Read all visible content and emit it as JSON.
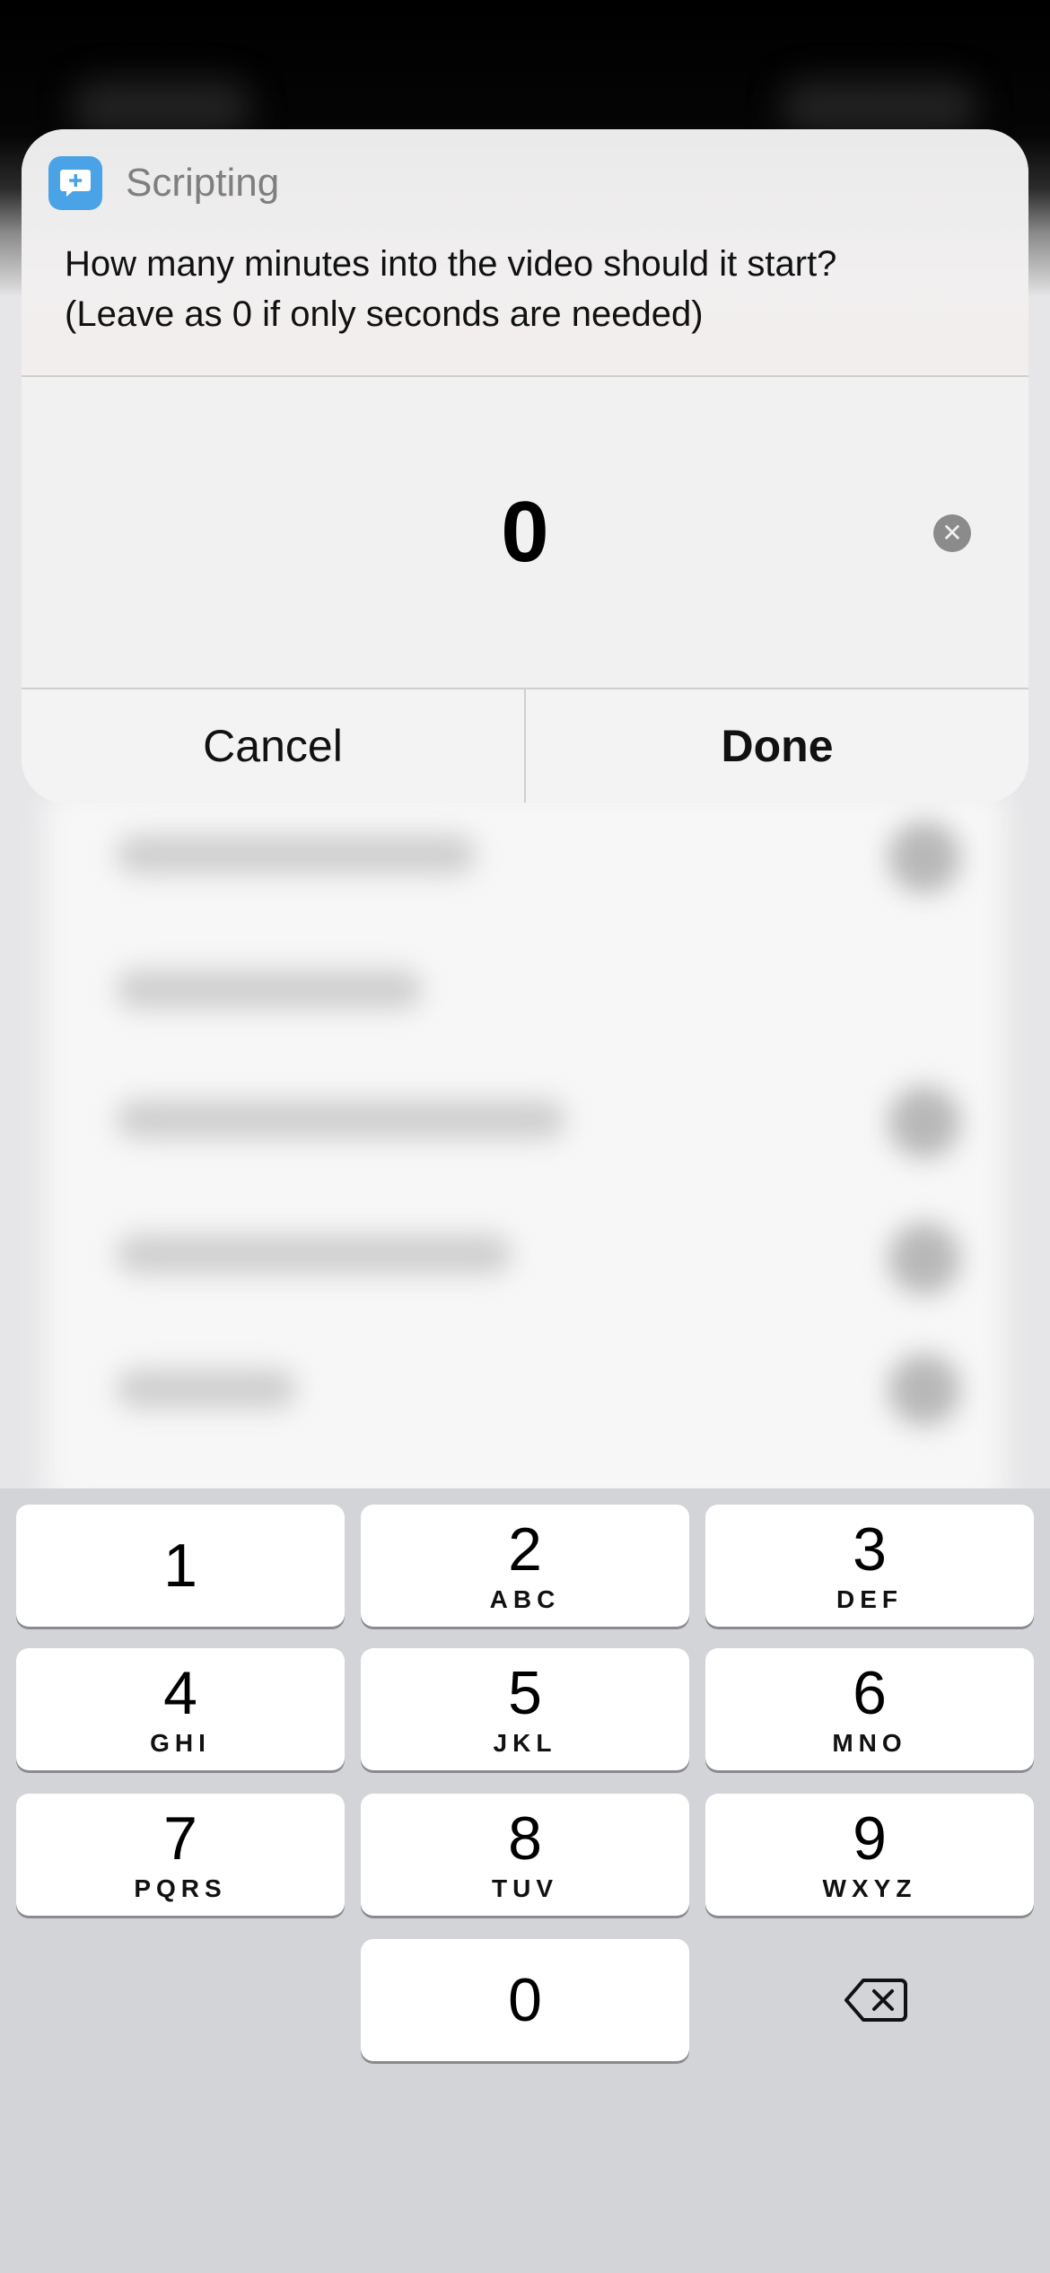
{
  "alert": {
    "app_name": "Scripting",
    "app_icon": "chat-bubble-plus-icon",
    "message_line1": "How many minutes into the video should it start?",
    "message_line2": "(Leave as 0 if only seconds are needed)",
    "input_value": "0",
    "clear_icon": "clear-x-icon",
    "cancel_label": "Cancel",
    "done_label": "Done"
  },
  "keypad": {
    "keys": [
      {
        "digit": "1",
        "letters": ""
      },
      {
        "digit": "2",
        "letters": "ABC"
      },
      {
        "digit": "3",
        "letters": "DEF"
      },
      {
        "digit": "4",
        "letters": "GHI"
      },
      {
        "digit": "5",
        "letters": "JKL"
      },
      {
        "digit": "6",
        "letters": "MNO"
      },
      {
        "digit": "7",
        "letters": "PQRS"
      },
      {
        "digit": "8",
        "letters": "TUV"
      },
      {
        "digit": "9",
        "letters": "WXYZ"
      },
      {
        "digit": "0",
        "letters": ""
      }
    ],
    "backspace_icon": "backspace-icon"
  },
  "colors": {
    "app_icon_bg": "#4aa3e6",
    "keypad_bg": "#d3d4d8",
    "key_bg": "#ffffff"
  }
}
